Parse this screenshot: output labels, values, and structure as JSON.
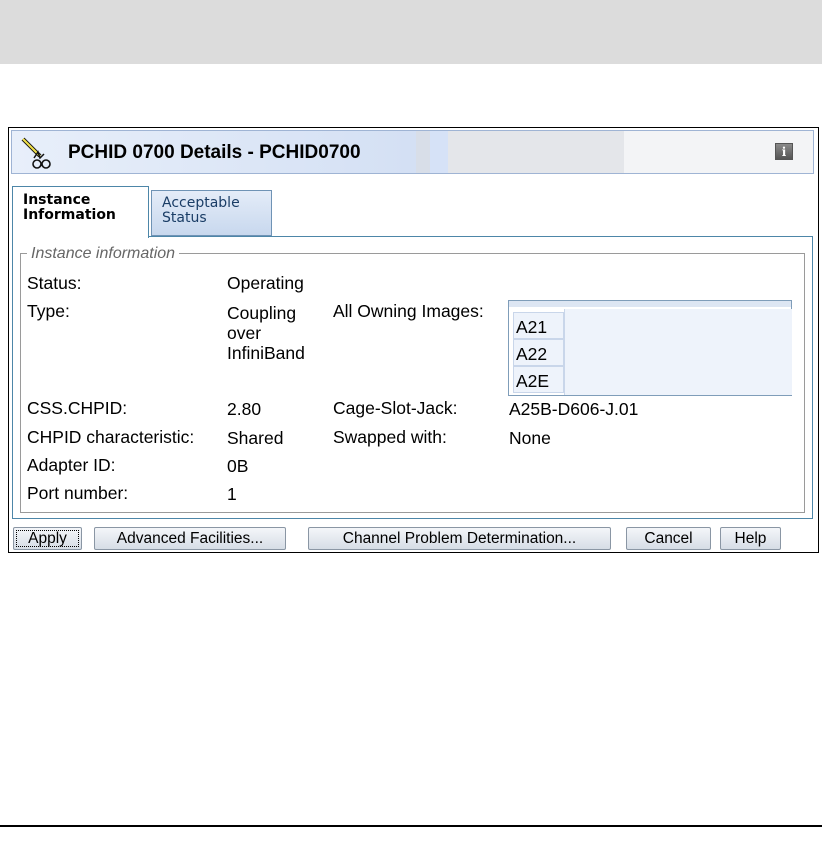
{
  "window": {
    "title": "PCHID 0700 Details - PCHID0700",
    "info_button_label": "i"
  },
  "tabs": [
    {
      "label_line1": "Instance",
      "label_line2": "Information",
      "active": true
    },
    {
      "label_line1": "Acceptable",
      "label_line2": "Status",
      "active": false
    }
  ],
  "instance_info": {
    "group_label": "Instance information",
    "status_label": "Status:",
    "status_value": "Operating",
    "type_label": "Type:",
    "type_value_line1": "Coupling",
    "type_value_line2": "over",
    "type_value_line3": "InfiniBand",
    "owning_images_label": "All Owning Images:",
    "owning_images": [
      "A21",
      "A22",
      "A2E"
    ],
    "css_chpid_label": "CSS.CHPID:",
    "css_chpid_value": "2.80",
    "cage_slot_jack_label": "Cage-Slot-Jack:",
    "cage_slot_jack_value": "A25B-D606-J.01",
    "chpid_char_label": "CHPID characteristic:",
    "chpid_char_value": "Shared",
    "swapped_label": "Swapped with:",
    "swapped_value": "None",
    "adapter_id_label": "Adapter ID:",
    "adapter_id_value": "0B",
    "port_number_label": "Port number:",
    "port_number_value": "1"
  },
  "buttons": {
    "apply": "Apply",
    "advanced": "Advanced Facilities...",
    "channel_problem": "Channel Problem Determination...",
    "cancel": "Cancel",
    "help": "Help"
  },
  "colors": {
    "tab_border": "#4d86a8",
    "titlebar_accent": "#d4e0f4"
  }
}
